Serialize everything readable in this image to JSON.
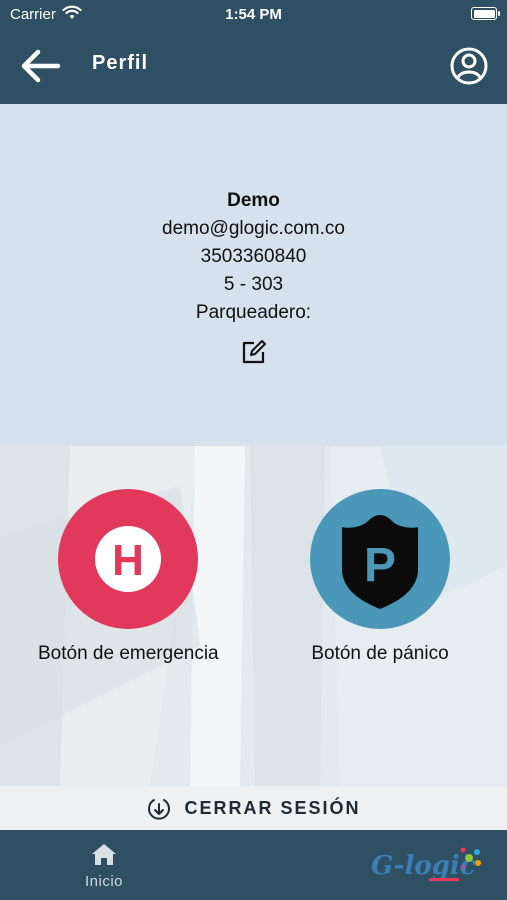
{
  "status_bar": {
    "carrier": "Carrier",
    "time": "1:54 PM"
  },
  "header": {
    "title": "Perfil"
  },
  "profile": {
    "name": "Demo",
    "email": "demo@glogic.com.co",
    "phone": "3503360840",
    "unit": "5 - 303",
    "parking": "Parqueadero:"
  },
  "actions": {
    "emergency": {
      "letter": "H",
      "label": "Botón de emergencia",
      "color": "#e2385b"
    },
    "panic": {
      "letter": "P",
      "label": "Botón de pánico",
      "color": "#4a97b7"
    }
  },
  "logout": {
    "label": "CERRAR SESIÓN"
  },
  "tab_bar": {
    "home_label": "Inicio",
    "logo_text": "G-logic"
  },
  "colors": {
    "primary": "#2f4f63",
    "card": "#d5e1ed"
  }
}
